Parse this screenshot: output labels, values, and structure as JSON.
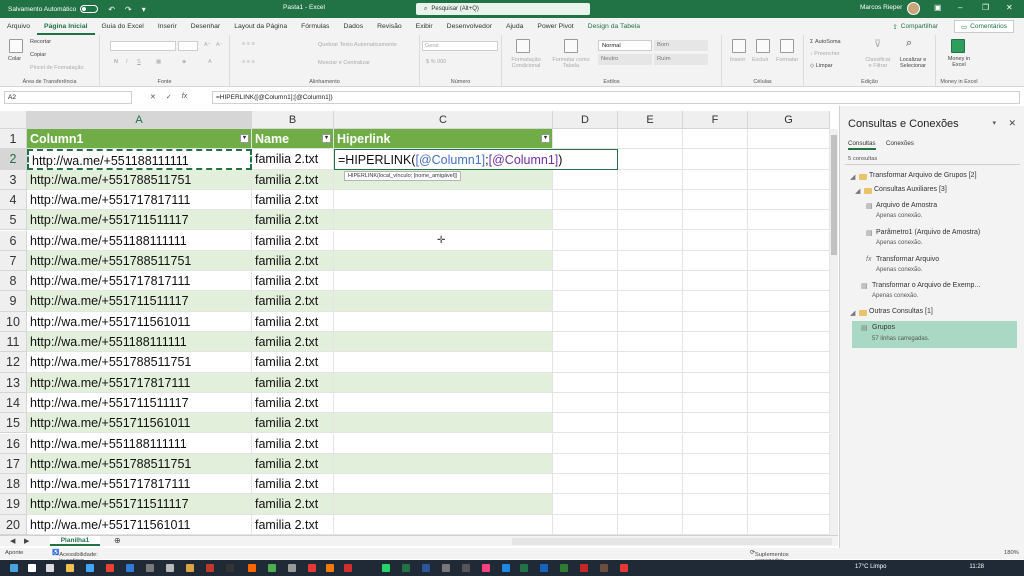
{
  "titlebar": {
    "autosave_label": "Salvamento Automático",
    "doc_title": "Pasta1 - Excel",
    "search_placeholder": "Pesquisar (Alt+Q)",
    "user_name": "Marcos Rieper"
  },
  "tabs": [
    "Arquivo",
    "Página Inicial",
    "Guia do Excel",
    "Inserir",
    "Desenhar",
    "Layout da Página",
    "Fórmulas",
    "Dados",
    "Revisão",
    "Exibir",
    "Desenvolvedor",
    "Ajuda",
    "Power Pivot",
    "Design da Tabela"
  ],
  "tab_actions": {
    "share": "Compartilhar",
    "comments": "Comentários"
  },
  "ribbon": {
    "clipboard": {
      "paste": "Colar",
      "cut": "Recortar",
      "copy": "Copiar",
      "painter": "Pincel de Formatação",
      "label": "Área de Transferência"
    },
    "font": {
      "label": "Fonte",
      "bold": "N",
      "italic": "I",
      "underline": "S"
    },
    "alignment": {
      "wrap": "Quebrar Texto Automaticamente",
      "merge": "Mesclar e Centralizar",
      "label": "Alinhamento"
    },
    "number": {
      "format": "Geral",
      "label": "Número"
    },
    "styles": {
      "cond": "Formatação Condicional",
      "table": "Formatar como Tabela",
      "normal": "Normal",
      "bom": "Bom",
      "neutro": "Neutro",
      "ruim": "Ruim",
      "label": "Estilos"
    },
    "cells": {
      "insert": "Inserir",
      "delete": "Excluir",
      "format": "Formatar",
      "label": "Células"
    },
    "editing": {
      "autosum": "AutoSoma",
      "fill": "Preencher",
      "clear": "Limpar",
      "sort": "Classificar e Filtrar",
      "find": "Localizar e Selecionar",
      "label": "Edição"
    },
    "money": {
      "button": "Money in Excel",
      "label": "Money in Excel"
    }
  },
  "formula_bar": {
    "name_box": "A2",
    "formula": "=HIPERLINK([@Column1];[@Column1])"
  },
  "grid": {
    "columns": [
      "A",
      "B",
      "C",
      "D",
      "E",
      "F",
      "G"
    ],
    "headers": [
      "Column1",
      "Name",
      "Hiperlink"
    ],
    "edit_prefix": "=HIPERLINK(",
    "edit_ref1": "[@Column1]",
    "edit_sep": ";",
    "edit_ref2": "[@Column1]",
    "edit_suffix": ")",
    "tooltip": "HIPERLINK(local_vínculo; [nome_amigável])",
    "rows": [
      {
        "num": "1"
      },
      {
        "num": "2",
        "a": "http://wa.me/+551188111111",
        "b": "familia 2.txt"
      },
      {
        "num": "3",
        "a": "http://wa.me/+551788511751",
        "b": "familia 2.txt"
      },
      {
        "num": "4",
        "a": "http://wa.me/+551717817111",
        "b": "familia 2.txt"
      },
      {
        "num": "5",
        "a": "http://wa.me/+551711511117",
        "b": "familia 2.txt"
      },
      {
        "num": "6",
        "a": "http://wa.me/+551188111111",
        "b": "familia 2.txt"
      },
      {
        "num": "7",
        "a": "http://wa.me/+551788511751",
        "b": "familia 2.txt"
      },
      {
        "num": "8",
        "a": "http://wa.me/+551717817111",
        "b": "familia 2.txt"
      },
      {
        "num": "9",
        "a": "http://wa.me/+551711511117",
        "b": "familia 2.txt"
      },
      {
        "num": "10",
        "a": "http://wa.me/+551711561011",
        "b": "familia 2.txt"
      },
      {
        "num": "11",
        "a": "http://wa.me/+551188111111",
        "b": "familia 2.txt"
      },
      {
        "num": "12",
        "a": "http://wa.me/+551788511751",
        "b": "familia 2.txt"
      },
      {
        "num": "13",
        "a": "http://wa.me/+551717817111",
        "b": "familia 2.txt"
      },
      {
        "num": "14",
        "a": "http://wa.me/+551711511117",
        "b": "familia 2.txt"
      },
      {
        "num": "15",
        "a": "http://wa.me/+551711561011",
        "b": "familia 2.txt"
      },
      {
        "num": "16",
        "a": "http://wa.me/+551188111111",
        "b": "familia 2.txt"
      },
      {
        "num": "17",
        "a": "http://wa.me/+551788511751",
        "b": "familia 2.txt"
      },
      {
        "num": "18",
        "a": "http://wa.me/+551717817111",
        "b": "familia 2.txt"
      },
      {
        "num": "19",
        "a": "http://wa.me/+551711511117",
        "b": "familia 2.txt"
      },
      {
        "num": "20",
        "a": "http://wa.me/+551711561011",
        "b": "familia 2.txt"
      }
    ]
  },
  "sheet_tabs": [
    "Planilha1"
  ],
  "statusbar": {
    "mode": "Aponte",
    "accessibility": "Acessibilidade: investigar",
    "addins": "Suplementos carregados com êxito",
    "zoom": "180%"
  },
  "pane": {
    "title": "Consultas e Conexões",
    "tabs": [
      "Consultas",
      "Conexões"
    ],
    "count": "5 consultas",
    "items": [
      {
        "label": "Transformar Arquivo de Grupos [2]"
      },
      {
        "label": "Consultas Auxiliares [3]"
      },
      {
        "label": "Arquivo de Amostra",
        "sub": "Apenas conexão."
      },
      {
        "label": "Parâmetro1 (Arquivo de Amostra)",
        "sub": "Apenas conexão."
      },
      {
        "label": "Transformar Arquivo",
        "sub": "Apenas conexão."
      },
      {
        "label": "Transformar o Arquivo de Exemp...",
        "sub": "Apenas conexão."
      },
      {
        "label": "Outras Consultas [1]"
      },
      {
        "label": "Grupos",
        "sub": "57 linhas carregadas."
      }
    ]
  },
  "taskbar": {
    "weather": "17°C Limpo",
    "time": "11:28"
  },
  "colors": {
    "excel_green": "#217346",
    "table_header": "#70ad47",
    "band": "#e2efda",
    "selected_query": "#a9d9c4"
  }
}
